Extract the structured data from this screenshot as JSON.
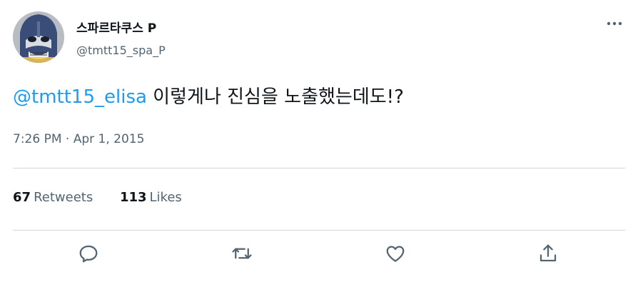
{
  "user": {
    "display_name": "스파르타쿠스 P",
    "handle": "@tmtt15_spa_P"
  },
  "tweet": {
    "mention": "@tmtt15_elisa",
    "text": " 이렇게나 진심을 노출했는데도!?",
    "timestamp": "7:26 PM · Apr 1, 2015"
  },
  "stats": {
    "retweets_count": "67",
    "retweets_label": "Retweets",
    "likes_count": "113",
    "likes_label": "Likes"
  },
  "icons": {
    "more": "more-horizontal-icon",
    "reply": "reply-icon",
    "retweet": "retweet-icon",
    "like": "like-icon",
    "share": "share-icon"
  },
  "colors": {
    "accent": "#1d9bf0",
    "text": "#0f1419",
    "secondary": "#536471",
    "divider": "#cfd9de"
  }
}
